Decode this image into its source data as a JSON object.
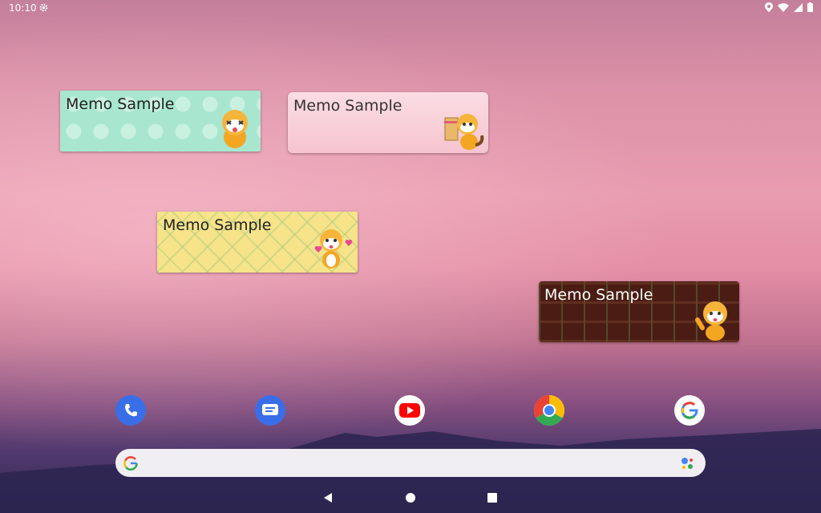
{
  "status_bar": {
    "time": "10:10"
  },
  "widgets": [
    {
      "text": "Memo Sample",
      "theme": "mint-polka"
    },
    {
      "text": "Memo Sample",
      "theme": "pink-bokeh"
    },
    {
      "text": "Memo Sample",
      "theme": "yellow-check"
    },
    {
      "text": "Memo Sample",
      "theme": "brown-plaid"
    }
  ],
  "dock": [
    {
      "app": "Phone",
      "icon": "phone-icon",
      "color": "#3a6ee8"
    },
    {
      "app": "Messages",
      "icon": "messages-icon",
      "color": "#3a6ee8"
    },
    {
      "app": "YouTube",
      "icon": "youtube-icon",
      "color": "#ff0000"
    },
    {
      "app": "Chrome",
      "icon": "chrome-icon",
      "color": "#4285f4"
    },
    {
      "app": "Google",
      "icon": "google-icon",
      "color": "#4285f4"
    }
  ],
  "search_bar": {
    "icon": "google-g-icon",
    "assistant_icon": "assistant-icon"
  },
  "nav": {
    "back": "back-icon",
    "home": "home-icon",
    "recents": "recents-icon"
  }
}
